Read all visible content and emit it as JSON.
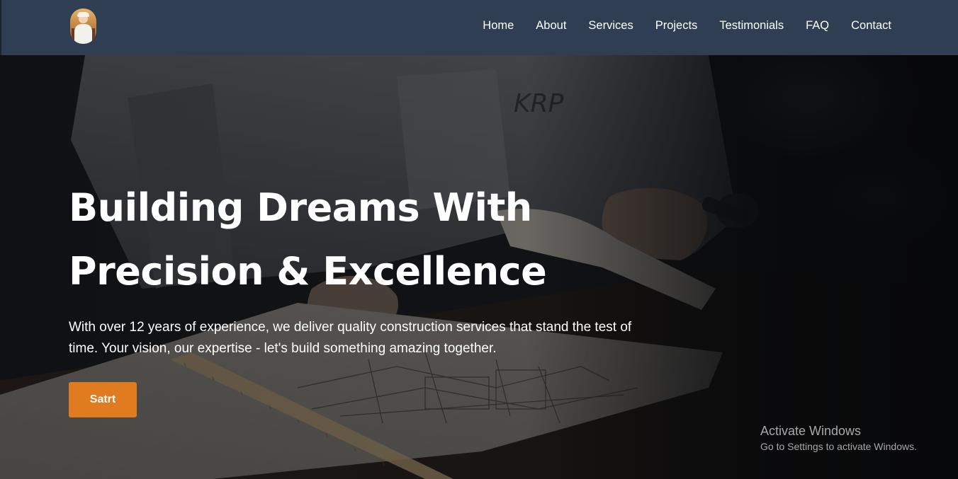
{
  "nav": {
    "logo": "logo-avatar",
    "links": [
      "Home",
      "About",
      "Services",
      "Projects",
      "Testimonials",
      "FAQ",
      "Contact"
    ]
  },
  "hero": {
    "title_line1": "Building Dreams With",
    "title_line2": "Precision & Excellence",
    "description": "With over 12 years of experience, we deliver quality construction services that stand the test of time. Your vision, our expertise - let's build something amazing together.",
    "button_label": "Satrt",
    "background_description_icon": "architect-blueprint-photo"
  },
  "watermark": {
    "title": "Activate Windows",
    "subtitle": "Go to Settings to activate Windows."
  },
  "colors": {
    "navbar": "#2f3e52",
    "accent": "#e07b20",
    "text": "#ffffff"
  }
}
